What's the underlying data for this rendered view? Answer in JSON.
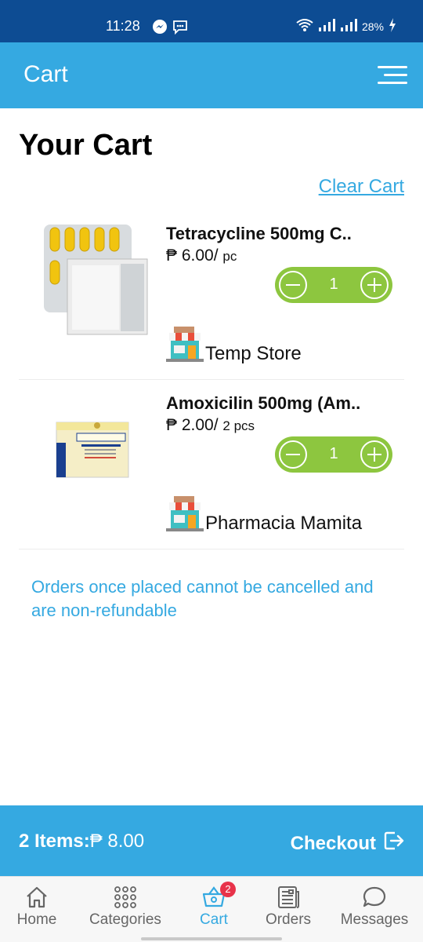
{
  "status_bar": {
    "time": "11:28",
    "battery": "28%"
  },
  "app_bar": {
    "title": "Cart"
  },
  "page": {
    "title": "Your Cart",
    "clear_cart": "Clear Cart"
  },
  "items": [
    {
      "name": "Tetracycline 500mg C..",
      "currency": "₱",
      "price": "6.00/",
      "unit": "pc",
      "quantity": "1",
      "store": "Temp Store"
    },
    {
      "name": "Amoxicilin 500mg (Am..",
      "currency": "₱",
      "price": "2.00/",
      "unit": "2 pcs",
      "quantity": "1",
      "store": "Pharmacia Mamita"
    }
  ],
  "notice": "Orders once placed cannot be cancelled and are non-refundable",
  "checkout_bar": {
    "items_label": "2 Items:",
    "currency": "₱",
    "total": "8.00",
    "checkout_label": "Checkout"
  },
  "bottom_nav": {
    "items": [
      {
        "label": "Home",
        "icon": "home-icon"
      },
      {
        "label": "Categories",
        "icon": "grid-dots-icon"
      },
      {
        "label": "Cart",
        "icon": "basket-icon",
        "badge": "2"
      },
      {
        "label": "Orders",
        "icon": "document-list-icon"
      },
      {
        "label": "Messages",
        "icon": "chat-bubble-icon"
      }
    ],
    "active": "Cart"
  },
  "colors": {
    "status_bar": "#0d4c93",
    "primary": "#35a9e1",
    "stepper": "#8dc63f",
    "badge": "#e8334a"
  }
}
